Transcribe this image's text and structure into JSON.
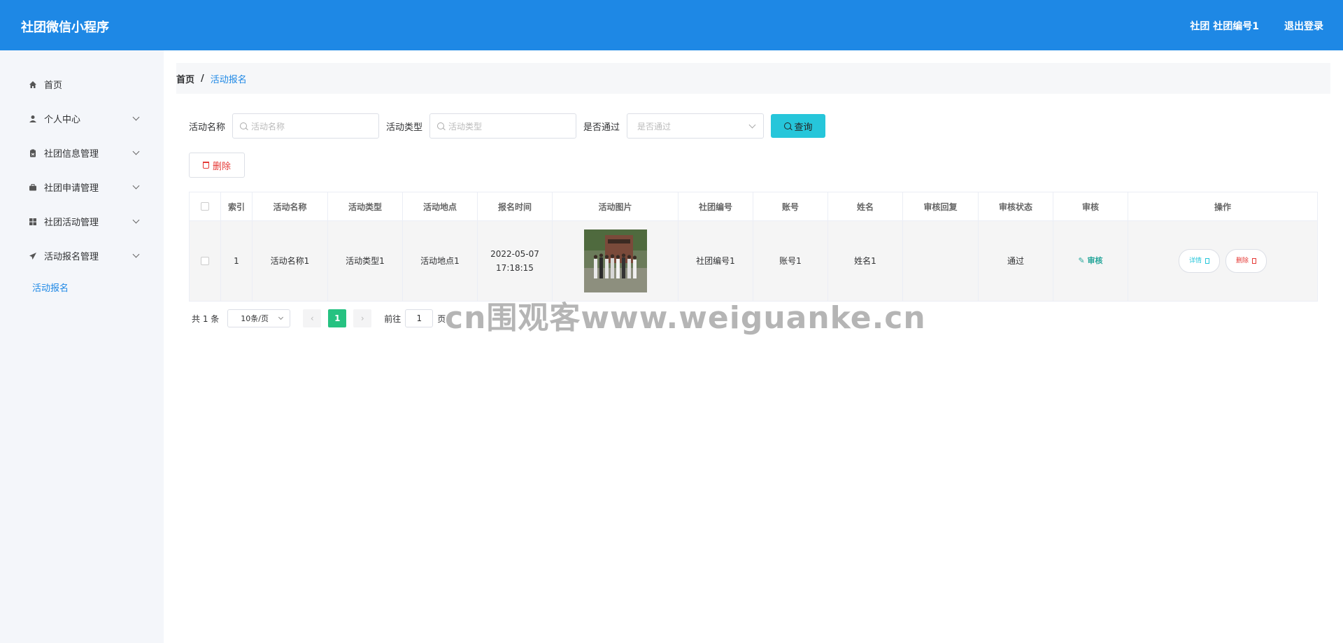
{
  "header": {
    "title": "社团微信小程序",
    "user": "社团 社团编号1",
    "logout": "退出登录"
  },
  "sidebar": {
    "items": [
      {
        "label": "首页",
        "icon": "home-icon"
      },
      {
        "label": "个人中心",
        "icon": "user-icon"
      },
      {
        "label": "社团信息管理",
        "icon": "clipboard-icon"
      },
      {
        "label": "社团申请管理",
        "icon": "briefcase-icon"
      },
      {
        "label": "社团活动管理",
        "icon": "grid-icon"
      },
      {
        "label": "活动报名管理",
        "icon": "send-icon"
      }
    ],
    "sub_item": "活动报名"
  },
  "breadcrumb": {
    "home": "首页",
    "separator": "/",
    "current": "活动报名"
  },
  "search": {
    "name_label": "活动名称",
    "name_placeholder": "活动名称",
    "type_label": "活动类型",
    "type_placeholder": "活动类型",
    "pass_label": "是否通过",
    "pass_placeholder": "是否通过",
    "query_button": "查询"
  },
  "toolbar": {
    "delete_button": "删除"
  },
  "table": {
    "headers": [
      "索引",
      "活动名称",
      "活动类型",
      "活动地点",
      "报名时间",
      "活动图片",
      "社团编号",
      "账号",
      "姓名",
      "审核回复",
      "审核状态",
      "审核",
      "操作"
    ],
    "rows": [
      {
        "index": "1",
        "name": "活动名称1",
        "type": "活动类型1",
        "location": "活动地点1",
        "time": "2022-05-07 17:18:15",
        "club_no": "社团编号1",
        "account": "账号1",
        "real_name": "姓名1",
        "reply": "",
        "status": "通过",
        "audit": "审核",
        "detail_btn": "详情",
        "delete_btn": "删除"
      }
    ]
  },
  "pagination": {
    "total": "共 1 条",
    "page_size": "10条/页",
    "prev": "‹",
    "current_page": "1",
    "next": "›",
    "goto_label": "前往",
    "goto_value": "1",
    "goto_suffix": "页"
  },
  "watermark": "cn围观客www.weiguanke.cn",
  "colors": {
    "header_bg": "#1e88e5",
    "search_button": "#26c6da",
    "active_page": "#26c281",
    "delete": "#e53935"
  }
}
